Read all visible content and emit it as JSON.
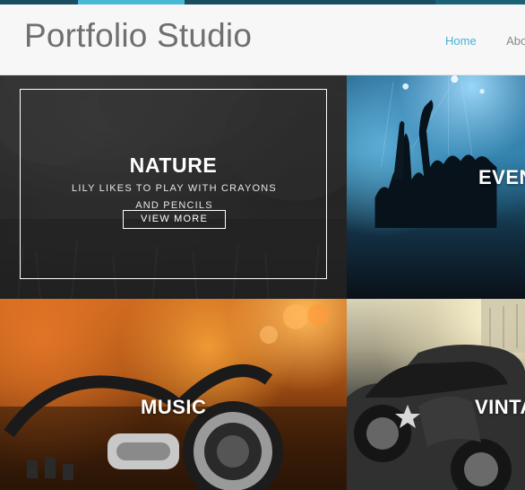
{
  "header": {
    "brand": "Portfolio Studio",
    "nav": [
      {
        "label": "Home",
        "active": true
      },
      {
        "label": "Abou",
        "active": false
      }
    ]
  },
  "tiles": {
    "nature": {
      "title": "NATURE",
      "description": "LILY LIKES TO PLAY WITH CRAYONS AND PENCILS",
      "button": "VIEW MORE"
    },
    "events": {
      "title": "EVEN"
    },
    "music": {
      "title": "MUSIC"
    },
    "vintage": {
      "title": "VINTA"
    }
  },
  "colors": {
    "accent": "#45b3d3",
    "topbar": "#1b4d60",
    "brand_text": "#6f6f6f"
  }
}
